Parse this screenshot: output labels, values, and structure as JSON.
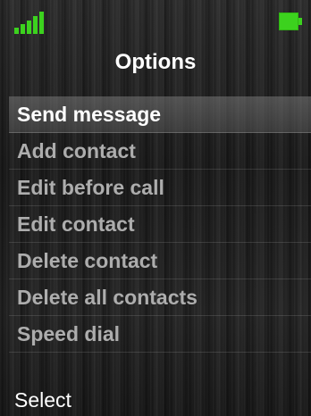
{
  "status_bar": {
    "signal_icon": "signal-strength-icon",
    "signal_level": 5,
    "battery_icon": "battery-icon",
    "battery_level_percent": 100,
    "accent_color": "#3cd21e"
  },
  "header": {
    "title": "Options"
  },
  "menu": {
    "selected_index": 0,
    "items": [
      {
        "label": "Send message"
      },
      {
        "label": "Add contact"
      },
      {
        "label": "Edit before call"
      },
      {
        "label": "Edit contact"
      },
      {
        "label": "Delete contact"
      },
      {
        "label": "Delete all contacts"
      },
      {
        "label": "Speed dial"
      }
    ]
  },
  "softkeys": {
    "left_label": "Select"
  }
}
